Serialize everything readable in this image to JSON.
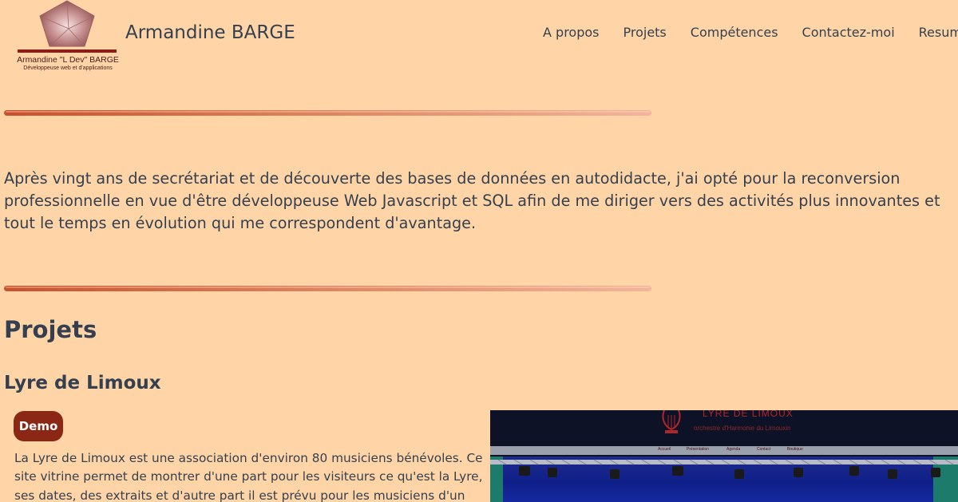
{
  "header": {
    "logo": {
      "name": "Armandine \"L Dev\" BARGE",
      "subtitle": "Développeuse web et d'applications"
    },
    "site_title": "Armandine BARGE",
    "nav": [
      {
        "label": "A propos"
      },
      {
        "label": "Projets"
      },
      {
        "label": "Compétences"
      },
      {
        "label": "Contactez-moi"
      },
      {
        "label": "Resume"
      }
    ]
  },
  "intro": {
    "text": "Après vingt ans de secrétariat et de découverte des bases de données en autodidacte, j'ai opté pour la reconversion professionnelle en vue d'être développeuse Web Javascript et SQL afin de me diriger vers des activités plus innovantes et tout le temps en évolution qui me correspondent d'avantage."
  },
  "projects": {
    "title": "Projets",
    "items": [
      {
        "title": "Lyre de Limoux",
        "demo_label": "Demo",
        "description": "La Lyre de Limoux est une association d'environ 80 musiciens bénévoles. Ce site vitrine permet de montrer d'une part pour les visiteurs ce qu'est la Lyre, ses dates, des extraits et d'autre part il est prévu pour les musiciens d'un accès",
        "screenshot": {
          "title": "LYRE DE LIMOUX",
          "subtitle": "orchestre d'Harmonie du Limouxin",
          "menu": [
            "Accueil",
            "Présentation",
            "Agenda",
            "Contact",
            "Boutique"
          ]
        }
      }
    ]
  },
  "colors": {
    "background": "#ffd5a8",
    "text": "#34404f",
    "accent": "#8b2714",
    "divider_start": "#c8512c",
    "divider_end": "#f3b49a"
  }
}
